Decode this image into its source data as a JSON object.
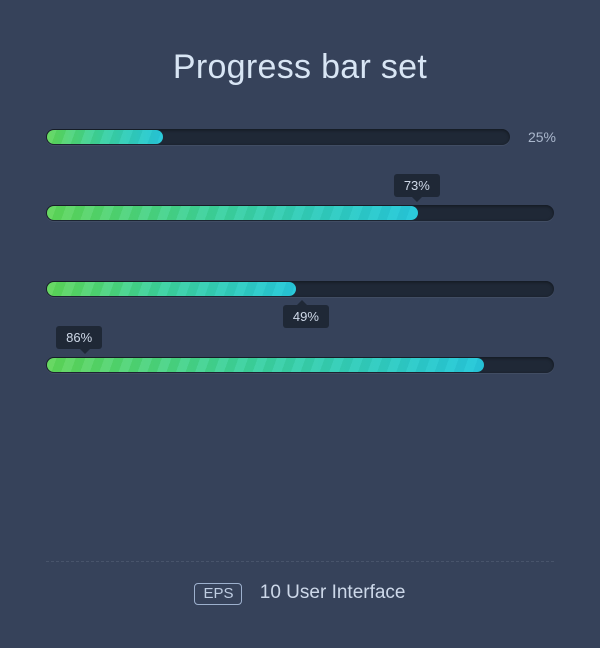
{
  "title": "Progress bar set",
  "bars": [
    {
      "percent": 25,
      "label": "25%",
      "label_style": "right"
    },
    {
      "percent": 73,
      "label": "73%",
      "label_style": "tooltip-top"
    },
    {
      "percent": 49,
      "label": "49%",
      "label_style": "tooltip-bottom"
    },
    {
      "percent": 86,
      "label": "86%",
      "label_style": "tooltip-left-top"
    }
  ],
  "footer": {
    "badge": "EPS",
    "text": "10 User Interface"
  },
  "colors": {
    "background": "#36425a",
    "track": "#1f2836",
    "fill_from": "#5fd459",
    "fill_to": "#27c4d8"
  }
}
